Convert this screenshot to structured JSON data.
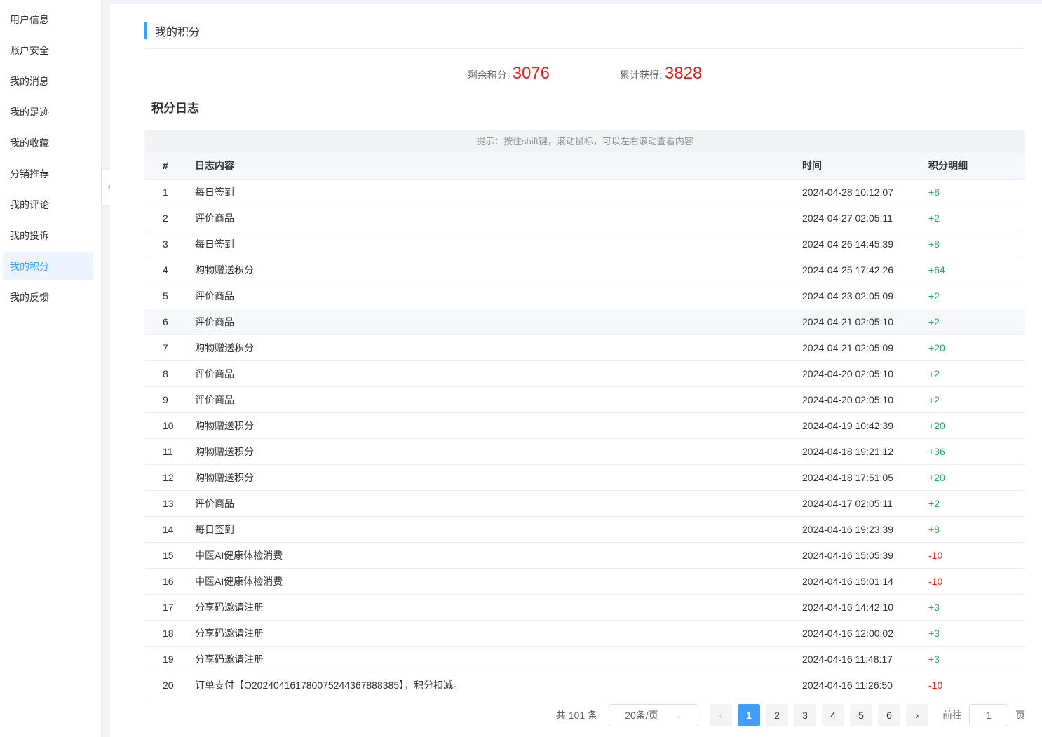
{
  "sidebar": {
    "items": [
      {
        "label": "用户信息"
      },
      {
        "label": "账户安全"
      },
      {
        "label": "我的消息"
      },
      {
        "label": "我的足迹"
      },
      {
        "label": "我的收藏"
      },
      {
        "label": "分销推荐"
      },
      {
        "label": "我的评论"
      },
      {
        "label": "我的投诉"
      },
      {
        "label": "我的积分",
        "active": true
      },
      {
        "label": "我的反馈"
      }
    ]
  },
  "page": {
    "title": "我的积分"
  },
  "summary": {
    "remaining_label": "剩余积分:",
    "remaining_value": "3076",
    "total_label": "累计获得:",
    "total_value": "3828"
  },
  "log": {
    "title": "积分日志",
    "tip": "提示：按住shift键，滚动鼠标，可以左右滚动查看内容",
    "columns": [
      "#",
      "日志内容",
      "时间",
      "积分明细"
    ],
    "rows": [
      {
        "idx": "1",
        "content": "每日签到",
        "time": "2024-04-28 10:12:07",
        "points": "+8"
      },
      {
        "idx": "2",
        "content": "评价商品",
        "time": "2024-04-27 02:05:11",
        "points": "+2"
      },
      {
        "idx": "3",
        "content": "每日签到",
        "time": "2024-04-26 14:45:39",
        "points": "+8"
      },
      {
        "idx": "4",
        "content": "购物赠送积分",
        "time": "2024-04-25 17:42:26",
        "points": "+64"
      },
      {
        "idx": "5",
        "content": "评价商品",
        "time": "2024-04-23 02:05:09",
        "points": "+2"
      },
      {
        "idx": "6",
        "content": "评价商品",
        "time": "2024-04-21 02:05:10",
        "points": "+2"
      },
      {
        "idx": "7",
        "content": "购物赠送积分",
        "time": "2024-04-21 02:05:09",
        "points": "+20"
      },
      {
        "idx": "8",
        "content": "评价商品",
        "time": "2024-04-20 02:05:10",
        "points": "+2"
      },
      {
        "idx": "9",
        "content": "评价商品",
        "time": "2024-04-20 02:05:10",
        "points": "+2"
      },
      {
        "idx": "10",
        "content": "购物赠送积分",
        "time": "2024-04-19 10:42:39",
        "points": "+20"
      },
      {
        "idx": "11",
        "content": "购物赠送积分",
        "time": "2024-04-18 19:21:12",
        "points": "+36"
      },
      {
        "idx": "12",
        "content": "购物赠送积分",
        "time": "2024-04-18 17:51:05",
        "points": "+20"
      },
      {
        "idx": "13",
        "content": "评价商品",
        "time": "2024-04-17 02:05:11",
        "points": "+2"
      },
      {
        "idx": "14",
        "content": "每日签到",
        "time": "2024-04-16 19:23:39",
        "points": "+8"
      },
      {
        "idx": "15",
        "content": "中医AI健康体检消费",
        "time": "2024-04-16 15:05:39",
        "points": "-10"
      },
      {
        "idx": "16",
        "content": "中医AI健康体检消费",
        "time": "2024-04-16 15:01:14",
        "points": "-10"
      },
      {
        "idx": "17",
        "content": "分享码邀请注册",
        "time": "2024-04-16 14:42:10",
        "points": "+3"
      },
      {
        "idx": "18",
        "content": "分享码邀请注册",
        "time": "2024-04-16 12:00:02",
        "points": "+3"
      },
      {
        "idx": "19",
        "content": "分享码邀请注册",
        "time": "2024-04-16 11:48:17",
        "points": "+3"
      },
      {
        "idx": "20",
        "content": "订单支付【O20240416178007524436788838​5】，积分扣减。",
        "time": "2024-04-16 11:26:50",
        "points": "-10"
      }
    ]
  },
  "pagination": {
    "total_text": "共 101 条",
    "page_size": "20条/页",
    "prev_icon": "chevron-left-icon",
    "next_icon": "chevron-right-icon",
    "pages": [
      "1",
      "2",
      "3",
      "4",
      "5",
      "6"
    ],
    "current": "1",
    "goto_label": "前往",
    "goto_value": "1",
    "goto_suffix": "页"
  },
  "colors": {
    "accent": "#409eff",
    "positive": "#26a65b",
    "negative": "#e02020"
  }
}
